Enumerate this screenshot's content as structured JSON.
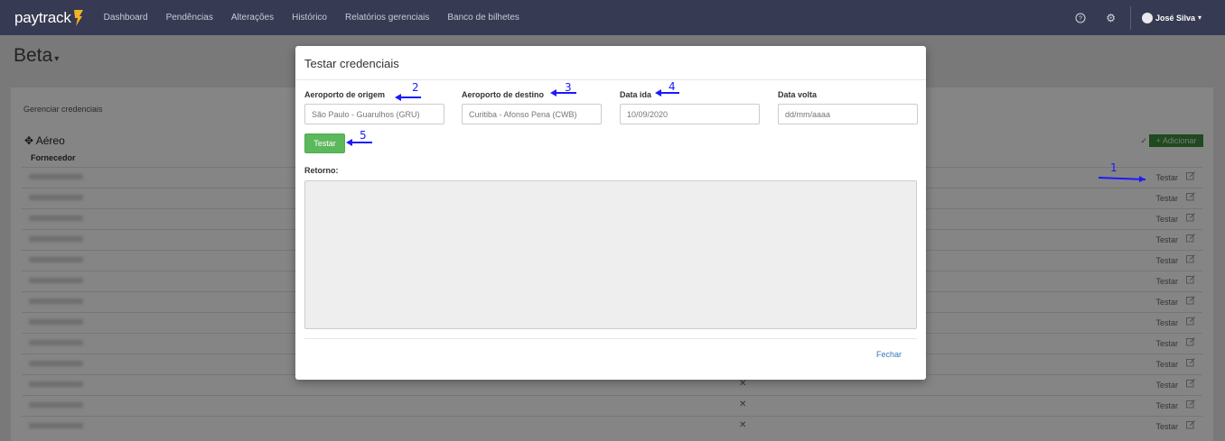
{
  "navbar": {
    "logo_text": "paytrack",
    "links": [
      "Dashboard",
      "Pendências",
      "Alterações",
      "Histórico",
      "Relatórios gerenciais",
      "Banco de bilhetes"
    ],
    "help_icon": "?",
    "settings_icon": "⚙",
    "user_name": "José Silva",
    "user_caret": "▾"
  },
  "page": {
    "title": "Beta",
    "title_caret": "▾"
  },
  "card": {
    "title": "Gerenciar credenciais",
    "section_icon": "✥",
    "section_title": "Aéreo",
    "column_fornecedor": "Fornecedor",
    "check_icon": "✓",
    "add_button": "+ Adicionar",
    "rows": [
      {
        "x": "",
        "test": "Testar"
      },
      {
        "x": "",
        "test": "Testar"
      },
      {
        "x": "",
        "test": "Testar"
      },
      {
        "x": "",
        "test": "Testar"
      },
      {
        "x": "",
        "test": "Testar"
      },
      {
        "x": "",
        "test": "Testar"
      },
      {
        "x": "",
        "test": "Testar"
      },
      {
        "x": "",
        "test": "Testar"
      },
      {
        "x": "",
        "test": "Testar"
      },
      {
        "x": "",
        "test": "Testar"
      },
      {
        "x": "✕",
        "test": "Testar"
      },
      {
        "x": "✕",
        "test": "Testar"
      },
      {
        "x": "✕",
        "test": "Testar"
      }
    ]
  },
  "modal": {
    "title": "Testar credenciais",
    "origin_label": "Aeroporto de origem",
    "origin_value": "São Paulo - Guarulhos (GRU)",
    "destination_label": "Aeroporto de destino",
    "destination_value": "Curitiba - Afonso Pena (CWB)",
    "departure_label": "Data ida",
    "departure_value": "10/09/2020",
    "return_label": "Data volta",
    "return_placeholder": "dd/mm/aaaa",
    "test_button": "Testar",
    "result_label": "Retorno:",
    "close_link": "Fechar"
  },
  "annotations": [
    "1",
    "2",
    "3",
    "4",
    "5"
  ],
  "colors": {
    "navbar": "#363a52",
    "primary_button": "#5cb85c",
    "add_button": "#3d8d3d",
    "link": "#337ab7",
    "annotation": "#1a1aff"
  }
}
